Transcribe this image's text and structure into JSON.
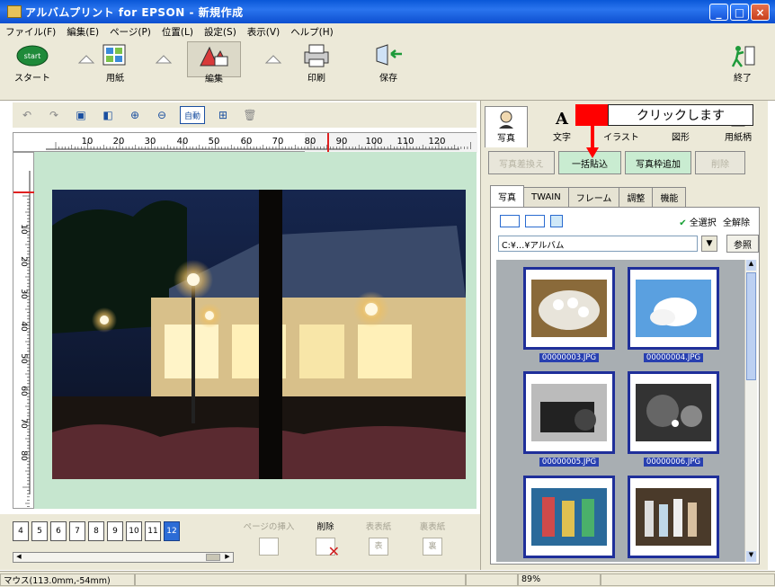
{
  "window": {
    "title": "アルバムプリント for EPSON - 新規作成",
    "buttons": {
      "minimize": "_",
      "maximize": "□",
      "close": "×"
    }
  },
  "menu": [
    "ファイル(F)",
    "編集(E)",
    "ページ(P)",
    "位置(L)",
    "設定(S)",
    "表示(V)",
    "ヘルプ(H)"
  ],
  "main_toolbar": {
    "start": "スタート",
    "paper": "用紙",
    "edit": "編集",
    "print": "印刷",
    "save": "保存",
    "exit": "終了"
  },
  "ruler": {
    "ticks": [
      "10",
      "20",
      "30",
      "40",
      "50",
      "60",
      "70",
      "80",
      "90",
      "100",
      "110",
      "120"
    ],
    "vticks": [
      "10",
      "20",
      "30",
      "40",
      "50",
      "60",
      "70",
      "80"
    ]
  },
  "sub_toolbar": {
    "fit": "自動"
  },
  "pages": {
    "numbers": [
      "4",
      "5",
      "6",
      "7",
      "8",
      "9",
      "10",
      "11",
      "12"
    ],
    "current": "12",
    "insert": "ページの挿入",
    "delete": "削除",
    "front": "表表紙",
    "back": "裏表紙",
    "front_btn": "表",
    "back_btn": "裏"
  },
  "right_panel": {
    "tabs": [
      "写真",
      "文字",
      "イラスト",
      "図形",
      "用紙柄"
    ],
    "actions": {
      "replace": "写真差換え",
      "paste_all": "一括貼込",
      "add_frame": "写真枠追加",
      "delete": "削除"
    },
    "subtabs": [
      "写真",
      "TWAIN",
      "フレーム",
      "調整",
      "機能"
    ],
    "select_all": "全選択",
    "deselect_all": "全解除",
    "path": "C:¥…¥アルバム",
    "browse": "参照",
    "thumbnails": [
      "00000003.JPG",
      "00000004.JPG",
      "00000005.JPG",
      "00000006.JPG"
    ]
  },
  "callout": {
    "text": "クリックします"
  },
  "status": {
    "mouse": "マウス(113.0mm,-54mm)",
    "zoom": "89%"
  }
}
